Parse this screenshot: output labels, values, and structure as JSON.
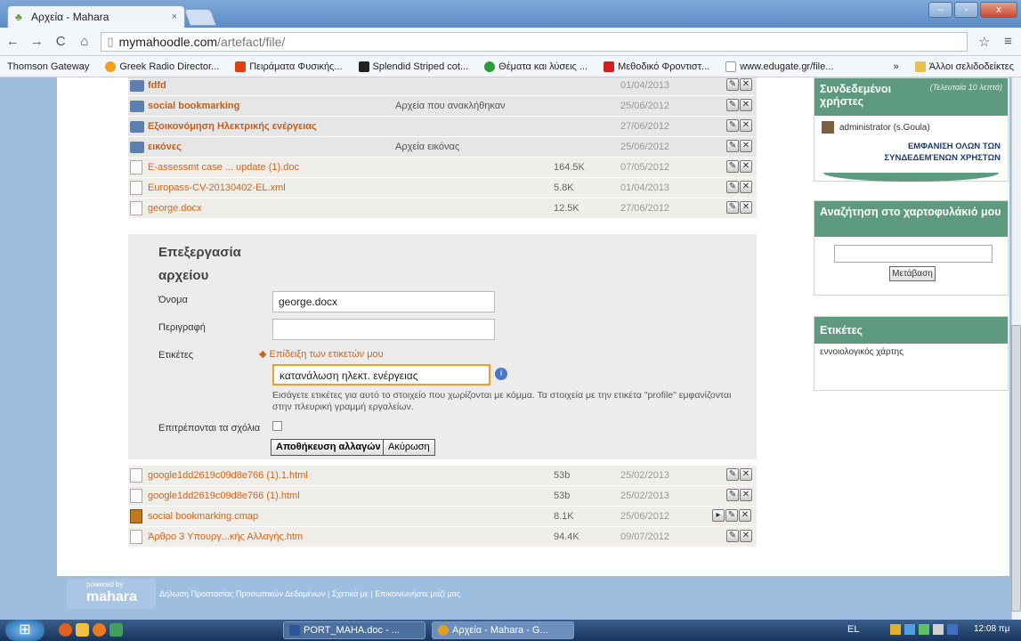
{
  "browser": {
    "tab_title": "Αρχεία - Mahara",
    "tab_close": "×",
    "url_host": "mymahoodle.com",
    "url_path": "/artefact/file/",
    "toolbar_back": "←",
    "toolbar_forward": "→",
    "toolbar_reload": "C",
    "toolbar_home": "⌂",
    "toolbar_star": "☆",
    "toolbar_menu": "≡",
    "bookmarks": [
      {
        "label": "Thomson Gateway",
        "color": "#f4f7fa"
      },
      {
        "label": "Greek Radio Director...",
        "color": "#f0a020"
      },
      {
        "label": "Πειράματα Φυσικής...",
        "color": "#e04010"
      },
      {
        "label": "Splendid Striped cot...",
        "color": "#222222"
      },
      {
        "label": "Θέματα και λύσεις ...",
        "color": "#2a9d3a"
      },
      {
        "label": "Μεθοδικό Φροντιστ...",
        "color": "#d02020"
      },
      {
        "label": "www.edugate.gr/file...",
        "color": "#ffffff"
      }
    ],
    "bookmarks_more": "»",
    "other_bookmarks": "Άλλοι σελιδοδείκτες"
  },
  "files": {
    "rows": [
      {
        "type": "folder",
        "name": "fdfd",
        "description": "",
        "size": "",
        "date": "01/04/2013"
      },
      {
        "type": "folder",
        "name": "social bookmarking",
        "description": "Αρχεία που ανακλήθηκαν",
        "size": "",
        "date": "25/06/2012"
      },
      {
        "type": "folder",
        "name": "Εξοικονόμηση Ηλεκτρικής ενέργειας",
        "description": "",
        "size": "",
        "date": "27/06/2012"
      },
      {
        "type": "folder",
        "name": "εικόνες",
        "description": "Αρχεία εικόνας",
        "size": "",
        "date": "25/06/2012"
      },
      {
        "type": "file",
        "name": "E-assessmt case ... update (1).doc",
        "description": "",
        "size": "164.5K",
        "date": "07/05/2012"
      },
      {
        "type": "file",
        "name": "Europass-CV-20130402-EL.xml",
        "description": "",
        "size": "5.8K",
        "date": "01/04/2013"
      },
      {
        "type": "file",
        "name": "george.docx",
        "description": "",
        "size": "12.5K",
        "date": "27/06/2012"
      }
    ],
    "rows_after": [
      {
        "type": "file",
        "name": "google1dd2619c09d8e766 (1).1.html",
        "description": "",
        "size": "53b",
        "date": "25/02/2013"
      },
      {
        "type": "file",
        "name": "google1dd2619c09d8e766 (1).html",
        "description": "",
        "size": "53b",
        "date": "25/02/2013"
      },
      {
        "type": "cmap",
        "name": "social bookmarking.cmap",
        "description": "",
        "size": "8.1K",
        "date": "25/06/2012"
      },
      {
        "type": "file",
        "name": "Άρθρο 3 Υπουργ...κής Αλλαγής.htm",
        "description": "",
        "size": "94.4K",
        "date": "09/07/2012"
      }
    ],
    "edit_icon": "✎",
    "delete_icon": "✕",
    "extra_icon": "▸"
  },
  "edit": {
    "title_line1": "Επεξεργασία",
    "title_line2": "αρχείου",
    "name_label": "Όνομα",
    "name_value": "george.docx",
    "description_label": "Περιγραφή",
    "description_value": "",
    "tags_label": "Ετικέτες",
    "show_tags_link": "Επίδειξη των ετικετών μου",
    "tags_value": "κατανάλωση ηλεκτ. ενέργειας",
    "tags_hint": "Εισάγετε ετικέτες για αυτό το στοιχείο που χωρίζονται με κόμμα. Τα στοιχεία με την ετικέτα \"profile\" εμφανίζονται στην πλευρική γραμμή εργαλείων.",
    "comments_label": "Επιτρέπονται τα σχόλια",
    "save_button": "Αποθήκευση αλλαγών",
    "cancel_button": "Ακύρωση"
  },
  "sidebar": {
    "online_title": "Συνδεδεμένοι χρήστες",
    "online_subtitle": "(Τελευταία 10 λεπτά)",
    "online_user": "administrator (s.Goula)",
    "online_all": "ΕΜΦΑΝΙΣΗ ΟΛΩΝ ΤΩΝ ΣΥΝΔΕΔΕΜΈΝΩΝ ΧΡΗΣΤΩΝ",
    "search_title": "Αναζήτηση στο χαρτοφυλάκιό μου",
    "search_value": "",
    "search_button": "Μετάβαση",
    "tags_title": "Ετικέτες",
    "tag_item": "εννοιολογικός χάρτης"
  },
  "footer": {
    "logo_small": "powered by",
    "logo": "mahara",
    "privacy": "Δήλωση Προστασίας Προσωπικών Δεδομένων",
    "sep": "|",
    "about": "Σχετικά με",
    "contact": "Επικοινωνήστε μαζί μας"
  },
  "taskbar": {
    "task1": "PORT_MAHA.doc - ...",
    "task2": "Αρχεία - Mahara - G...",
    "lang": "EL",
    "clock": "12:08 πμ"
  }
}
